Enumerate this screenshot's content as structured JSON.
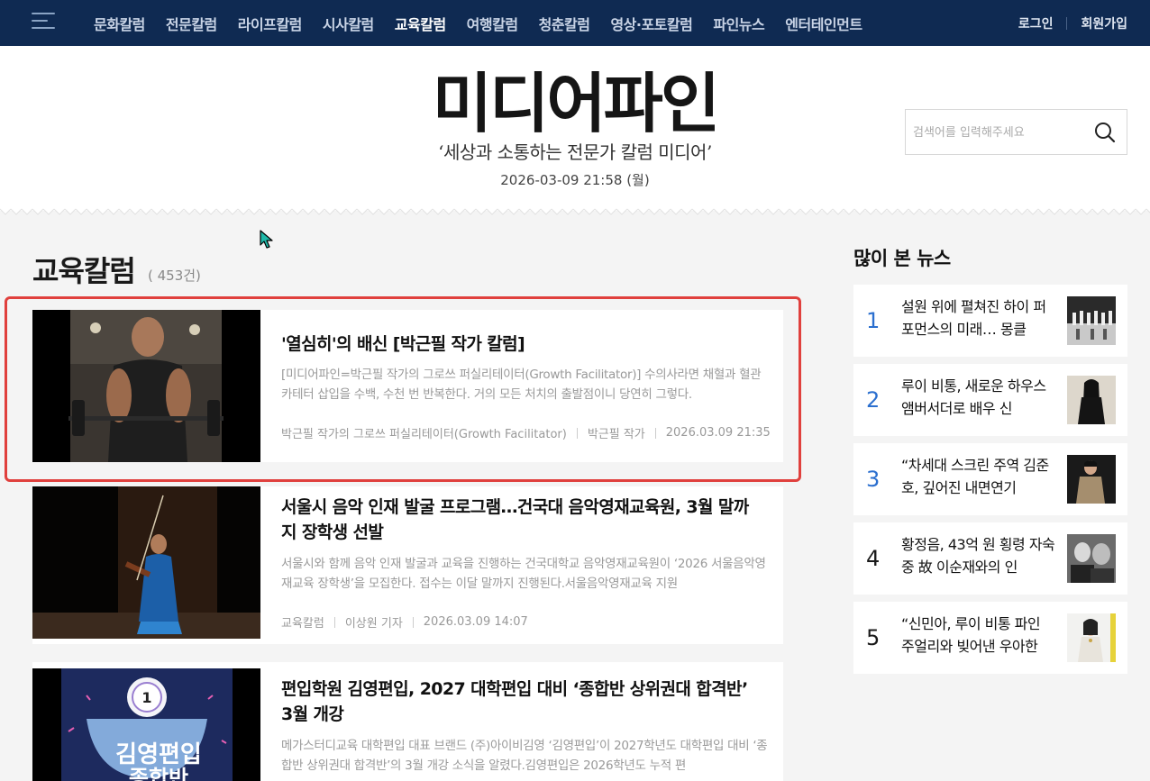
{
  "nav": {
    "items": [
      "문화칼럼",
      "전문칼럼",
      "라이프칼럼",
      "시사칼럼",
      "교육칼럼",
      "여행칼럼",
      "청춘칼럼",
      "영상·포토칼럼",
      "파인뉴스",
      "엔터테인먼트"
    ],
    "active_index": 4,
    "login": "로그인",
    "signup": "회원가입"
  },
  "header": {
    "logo": "미디어파인",
    "tagline": "‘세상과 소통하는 전문가 칼럼 미디어’",
    "date": "2026-03-09 21:58 (월)",
    "search_placeholder": "검색어를 입력해주세요"
  },
  "section": {
    "title": "교육칼럼",
    "count": "( 453건)"
  },
  "articles": [
    {
      "title": "'열심히'의 배신 [박근필 작가 칼럼]",
      "summary": "[미디어파인=박근필 작가의 그로쓰 퍼실리테이터(Growth Facilitator)] 수의사라면 채혈과 혈관 카테터 삽입을 수백, 수천 번 반복한다. 거의 모든 처치의 출발점이니 당연히 그렇다.",
      "category": "박근필 작가의 그로쓰 퍼실리테이터(Growth Facilitator)",
      "author": "박근필 작가",
      "date": "2026.03.09 21:35"
    },
    {
      "title": "서울시 음악 인재 발굴 프로그램…건국대 음악영재교육원, 3월 말까지 장학생 선발",
      "summary": "서울시와 함께 음악 인재 발굴과 교육을 진행하는 건국대학교 음악영재교육원이 ‘2026 서울음악영재교육 장학생’을 모집한다. 접수는 이달 말까지 진행된다.서울음악영재교육 지원",
      "category": "교육칼럼",
      "author": "이상원 기자",
      "date": "2026.03.09 14:07"
    },
    {
      "title": "편입학원 김영편입, 2027 대학편입 대비 ‘종합반 상위권대 합격반’ 3월 개강",
      "summary": "메가스터디교육 대학편입 대표 브랜드 (주)아이비김영 ‘김영편입’이 2027학년도 대학편입 대비 ‘종합반 상위권대 합격반’의 3월 개강 소식을 알렸다.김영편입은 2026학년도 누적 편",
      "category": "",
      "author": "",
      "date": "",
      "thumb_badge": "1",
      "thumb_text": "김영편입",
      "thumb_text2": "종합반"
    }
  ],
  "sidebar": {
    "title": "많이 본 뉴스",
    "items": [
      {
        "rank": "1",
        "text": "설원 위에 펼쳐진 하이 퍼포먼스의 미래… 몽클"
      },
      {
        "rank": "2",
        "text": "루이 비통, 새로운 하우스 앰버서더로 배우 신"
      },
      {
        "rank": "3",
        "text": "“차세대 스크린 주역 김준호, 깊어진 내면연기"
      },
      {
        "rank": "4",
        "text": "황정음, 43억 원 횡령 자숙 중 故 이순재와의 인"
      },
      {
        "rank": "5",
        "text": "“신민아, 루이 비통 파인 주얼리와 빚어낸 우아한"
      }
    ]
  },
  "colors": {
    "nav_bg": "#0f2a52",
    "accent_blue": "#2b6fcf",
    "highlight_red": "#e0403d"
  }
}
